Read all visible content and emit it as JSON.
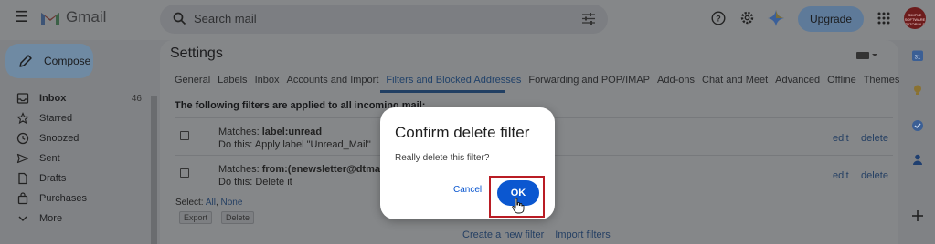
{
  "header": {
    "app_name": "Gmail",
    "search_placeholder": "Search mail",
    "upgrade_label": "Upgrade",
    "avatar_text": "SIMPLE SOFTWARE TUTORIALS"
  },
  "sidebar": {
    "compose_label": "Compose",
    "items": [
      {
        "label": "Inbox",
        "count": "46",
        "icon": "inbox-icon"
      },
      {
        "label": "Starred",
        "count": "",
        "icon": "star-icon"
      },
      {
        "label": "Snoozed",
        "count": "",
        "icon": "clock-icon"
      },
      {
        "label": "Sent",
        "count": "",
        "icon": "send-icon"
      },
      {
        "label": "Drafts",
        "count": "",
        "icon": "draft-icon"
      },
      {
        "label": "Purchases",
        "count": "",
        "icon": "bag-icon"
      },
      {
        "label": "More",
        "count": "",
        "icon": "chevron-down-icon"
      }
    ]
  },
  "settings": {
    "title": "Settings",
    "tabs": [
      "General",
      "Labels",
      "Inbox",
      "Accounts and Import",
      "Filters and Blocked Addresses",
      "Forwarding and POP/IMAP",
      "Add-ons",
      "Chat and Meet",
      "Advanced",
      "Offline",
      "Themes"
    ],
    "active_tab": "Filters and Blocked Addresses",
    "filters_heading": "The following filters are applied to all incoming mail:",
    "filters": [
      {
        "matches_prefix": "Matches: ",
        "matches_value": "label:unread",
        "do_this": "Do this: Apply label \"Unread_Mail\"",
        "edit": "edit",
        "delete": "delete"
      },
      {
        "matches_prefix": "Matches: ",
        "matches_value": "from:(enewsletter@dtmailing",
        "do_this": "Do this: Delete it",
        "edit": "edit",
        "delete": "delete"
      }
    ],
    "select_prefix": "Select: ",
    "select_all": "All",
    "select_sep": ", ",
    "select_none": "None",
    "export_label": "Export",
    "delete_label": "Delete",
    "create_filter": "Create a new filter",
    "import_filters": "Import filters"
  },
  "dialog": {
    "title": "Confirm delete filter",
    "message": "Really delete this filter?",
    "cancel_label": "Cancel",
    "ok_label": "OK"
  },
  "colors": {
    "primary_blue": "#0b57d0",
    "highlight_red": "#b91c24",
    "overlay_gray": "#808285"
  }
}
